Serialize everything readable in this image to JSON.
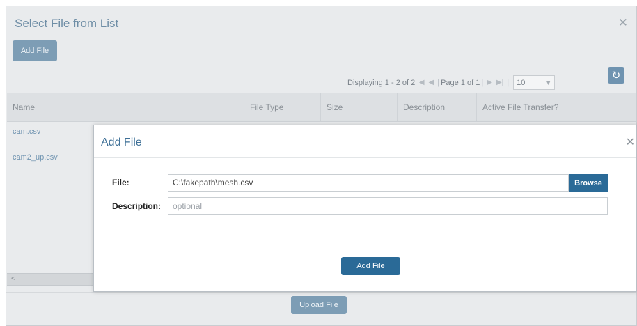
{
  "background_dialog": {
    "title": "Select File from List",
    "add_file_label": "Add File",
    "pager": {
      "displaying": "Displaying 1 - 2 of 2",
      "page_label": "Page",
      "page_number": "1",
      "of_label": "of 1",
      "page_size": "10"
    },
    "columns": [
      "Name",
      "File Type",
      "Size",
      "Description",
      "Active File Transfer?"
    ],
    "rows": [
      {
        "name": "cam.csv"
      },
      {
        "name": "cam2_up.csv"
      }
    ],
    "upload_label": "Upload File"
  },
  "modal": {
    "title": "Add File",
    "file_label": "File:",
    "file_value": "C:\\fakepath\\mesh.csv",
    "browse_label": "Browse",
    "description_label": "Description:",
    "description_placeholder": "optional",
    "submit_label": "Add File"
  },
  "colors": {
    "accent": "#2a6a97",
    "accent_muted": "#7d9db5",
    "link": "#6f93b0"
  },
  "icons": [
    "close-icon",
    "first-page-icon",
    "prev-page-icon",
    "next-page-icon",
    "last-page-icon",
    "refresh-icon",
    "scroll-left-icon",
    "dropdown-caret-icon"
  ]
}
